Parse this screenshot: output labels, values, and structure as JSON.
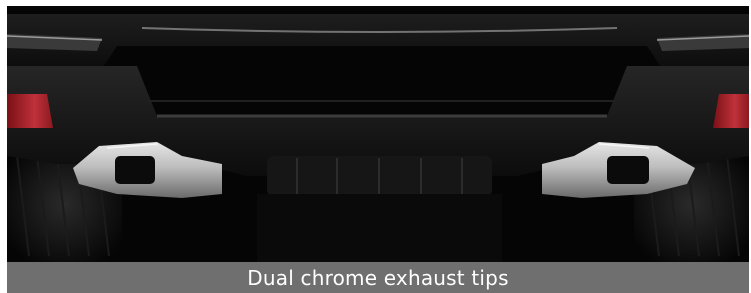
{
  "image": {
    "subject": "car-rear-exhaust-photo"
  },
  "caption": {
    "text": "Dual chrome exhaust tips"
  },
  "colors": {
    "caption_bar": "#6f6f6f",
    "caption_text": "#ffffff",
    "taillight": "#b5242b",
    "chrome": "#bdbdbd"
  }
}
